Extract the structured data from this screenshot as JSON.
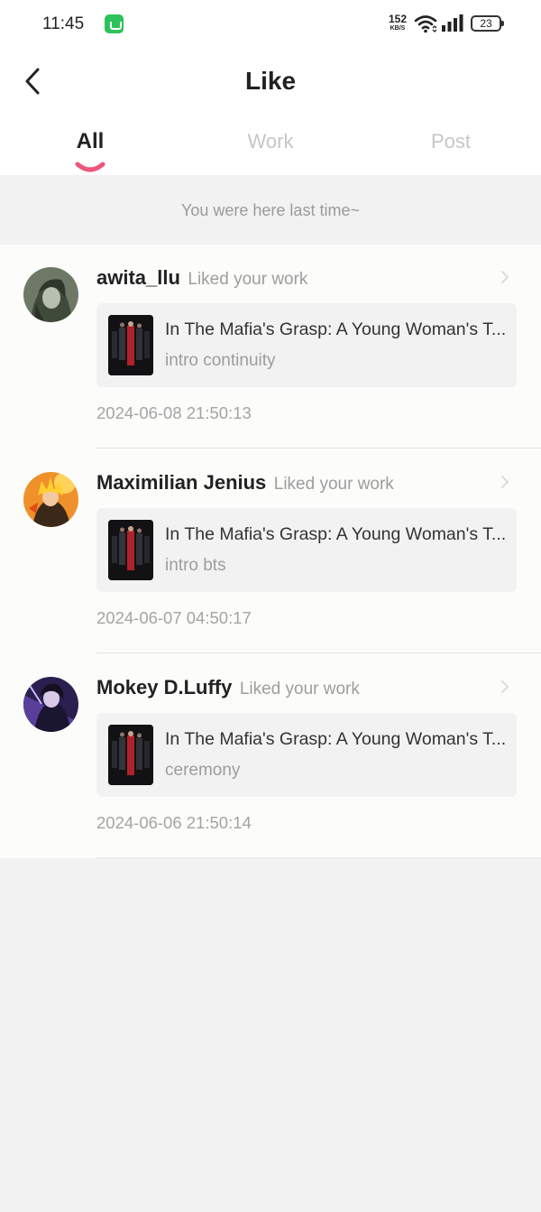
{
  "status_bar": {
    "time": "11:45",
    "net_speed": "152",
    "net_unit": "KB/S",
    "battery": "23"
  },
  "header": {
    "title": "Like",
    "tabs": [
      {
        "label": "All",
        "active": true
      },
      {
        "label": "Work",
        "active": false
      },
      {
        "label": "Post",
        "active": false
      }
    ]
  },
  "banner": {
    "text": "You were here last time~"
  },
  "notifications": [
    {
      "user": "awita_llu",
      "action": "Liked your work",
      "work_title": "In The Mafia's Grasp: A Young Woman's T...",
      "work_subtitle": "intro continuity",
      "time": "2024-06-08 21:50:13"
    },
    {
      "user": "Maximilian Jenius",
      "action": "Liked your work",
      "work_title": "In The Mafia's Grasp: A Young Woman's T...",
      "work_subtitle": "intro bts",
      "time": "2024-06-07 04:50:17"
    },
    {
      "user": "Mokey D.Luffy",
      "action": "Liked your work",
      "work_title": "In The Mafia's Grasp: A Young Woman's T...",
      "work_subtitle": "ceremony",
      "time": "2024-06-06 21:50:14"
    }
  ],
  "colors": {
    "accent": "#f0557a",
    "background": "#f2f2f2",
    "list_background": "#fcfcfa",
    "muted_text": "#9d9d9d"
  }
}
